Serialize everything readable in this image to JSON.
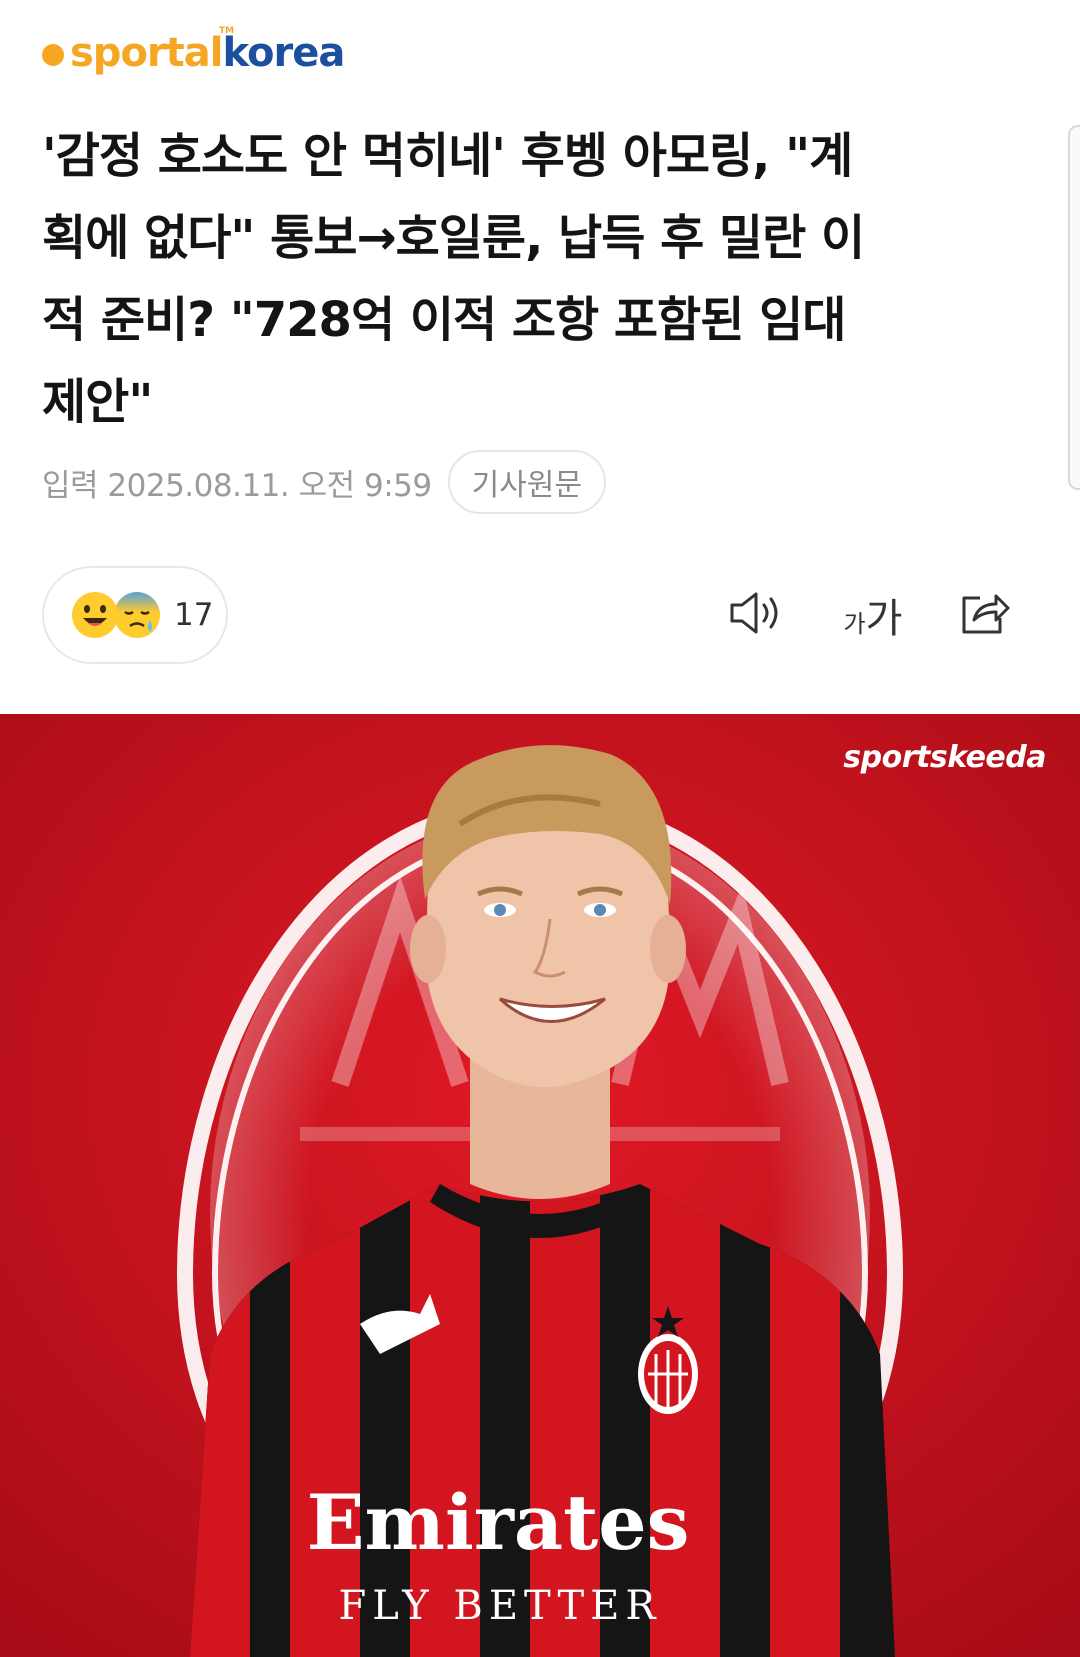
{
  "brand": {
    "logo_part1": "sportal",
    "logo_part2": "korea",
    "logo_tm": "TM",
    "color_dot": "#f5a623",
    "color_sportal": "#f5a623",
    "color_korea": "#1c4fa0"
  },
  "article": {
    "headline_lines": [
      "'감정 호소도 안 먹히네' 후벵 아모링, \"계",
      "획에 없다\" 통보→호일룬, 납득 후 밀란 이",
      "적 준비? \"728억 이적 조항 포함된 임대",
      "제안\""
    ],
    "published": "입력 2025.08.11. 오전 9:59",
    "source_button": "기사원문"
  },
  "reactions": {
    "count": "17",
    "emojis": [
      "smiling-face-icon",
      "sad-sweat-face-icon"
    ]
  },
  "tools": {
    "font_small": "가",
    "font_big": "가",
    "icons": [
      "speaker-icon",
      "font-size-icon",
      "share-icon"
    ]
  },
  "photo": {
    "watermark": "sportskeeda",
    "jersey_sponsor": "Emirates",
    "jersey_tagline": "FLY BETTER",
    "club_badge": "ACM 1899",
    "colors": {
      "background": "#c8101e",
      "stripe_red": "#d3151f",
      "stripe_black": "#151515",
      "crest_white": "#ffffff"
    }
  }
}
